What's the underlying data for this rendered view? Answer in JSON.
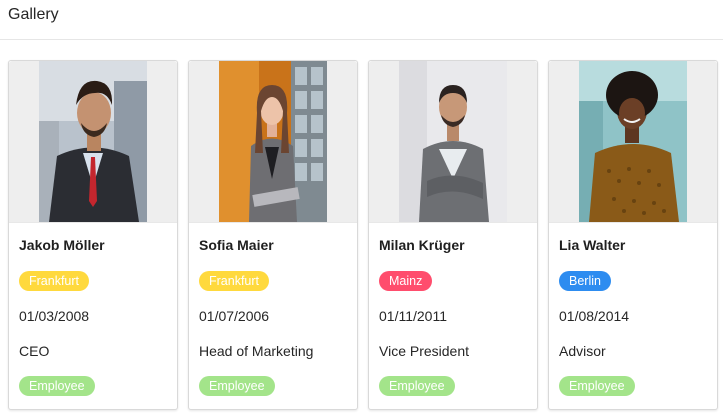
{
  "header": {
    "title": "Gallery"
  },
  "cards": [
    {
      "name": "Jakob Möller",
      "city": "Frankfurt",
      "city_bg": "#ffd93d",
      "city_fg": "#ffffff",
      "date": "01/03/2008",
      "title": "CEO",
      "status": "Employee",
      "status_bg": "#a3e48a"
    },
    {
      "name": "Sofia Maier",
      "city": "Frankfurt",
      "city_bg": "#ffd93d",
      "city_fg": "#ffffff",
      "date": "01/07/2006",
      "title": "Head of Marketing",
      "status": "Employee",
      "status_bg": "#a3e48a"
    },
    {
      "name": "Milan Krüger",
      "city": "Mainz",
      "city_bg": "#ff4d6d",
      "city_fg": "#ffffff",
      "date": "01/11/2011",
      "title": "Vice President",
      "status": "Employee",
      "status_bg": "#a3e48a"
    },
    {
      "name": "Lia Walter",
      "city": "Berlin",
      "city_bg": "#2d8cf0",
      "city_fg": "#ffffff",
      "date": "01/08/2014",
      "title": "Advisor",
      "status": "Employee",
      "status_bg": "#a3e48a"
    }
  ]
}
